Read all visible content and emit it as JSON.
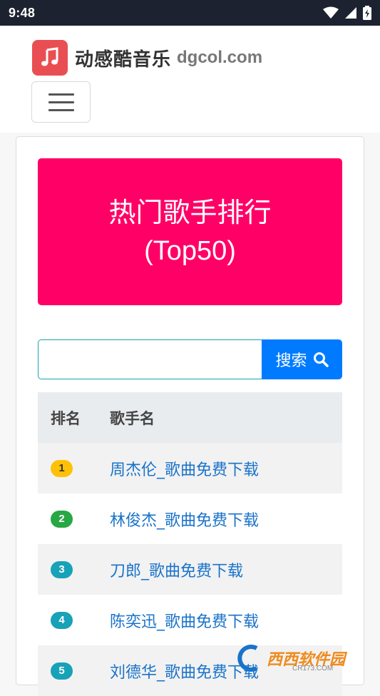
{
  "status_bar": {
    "time": "9:48",
    "icons": [
      "wifi-icon",
      "signal-icon",
      "battery-icon"
    ]
  },
  "header": {
    "brand_name": "动感酷音乐",
    "brand_domain": "dgcol.com",
    "logo_icon": "music-note-icon"
  },
  "banner": {
    "line1": "热门歌手排行",
    "line2": "(Top50)"
  },
  "search": {
    "placeholder": "",
    "value": "",
    "button_label": "搜索",
    "button_icon": "search-icon"
  },
  "table": {
    "headers": {
      "rank": "排名",
      "name": "歌手名"
    },
    "rows": [
      {
        "rank": "1",
        "name": "周杰伦_歌曲免费下载",
        "badge_color": "#ffc107",
        "badge_text_color": "#333333"
      },
      {
        "rank": "2",
        "name": "林俊杰_歌曲免费下载",
        "badge_color": "#28a745",
        "badge_text_color": "#ffffff"
      },
      {
        "rank": "3",
        "name": "刀郎_歌曲免费下载",
        "badge_color": "#17a2b8",
        "badge_text_color": "#ffffff"
      },
      {
        "rank": "4",
        "name": "陈奕迅_歌曲免费下载",
        "badge_color": "#17a2b8",
        "badge_text_color": "#ffffff"
      },
      {
        "rank": "5",
        "name": "刘德华_歌曲免费下载",
        "badge_color": "#17a2b8",
        "badge_text_color": "#ffffff"
      }
    ]
  },
  "watermark": {
    "text": "西西软件园",
    "sub": "CR173.COM"
  },
  "colors": {
    "accent": "#ff0066",
    "primary": "#007bff",
    "link": "#1a73c9"
  }
}
